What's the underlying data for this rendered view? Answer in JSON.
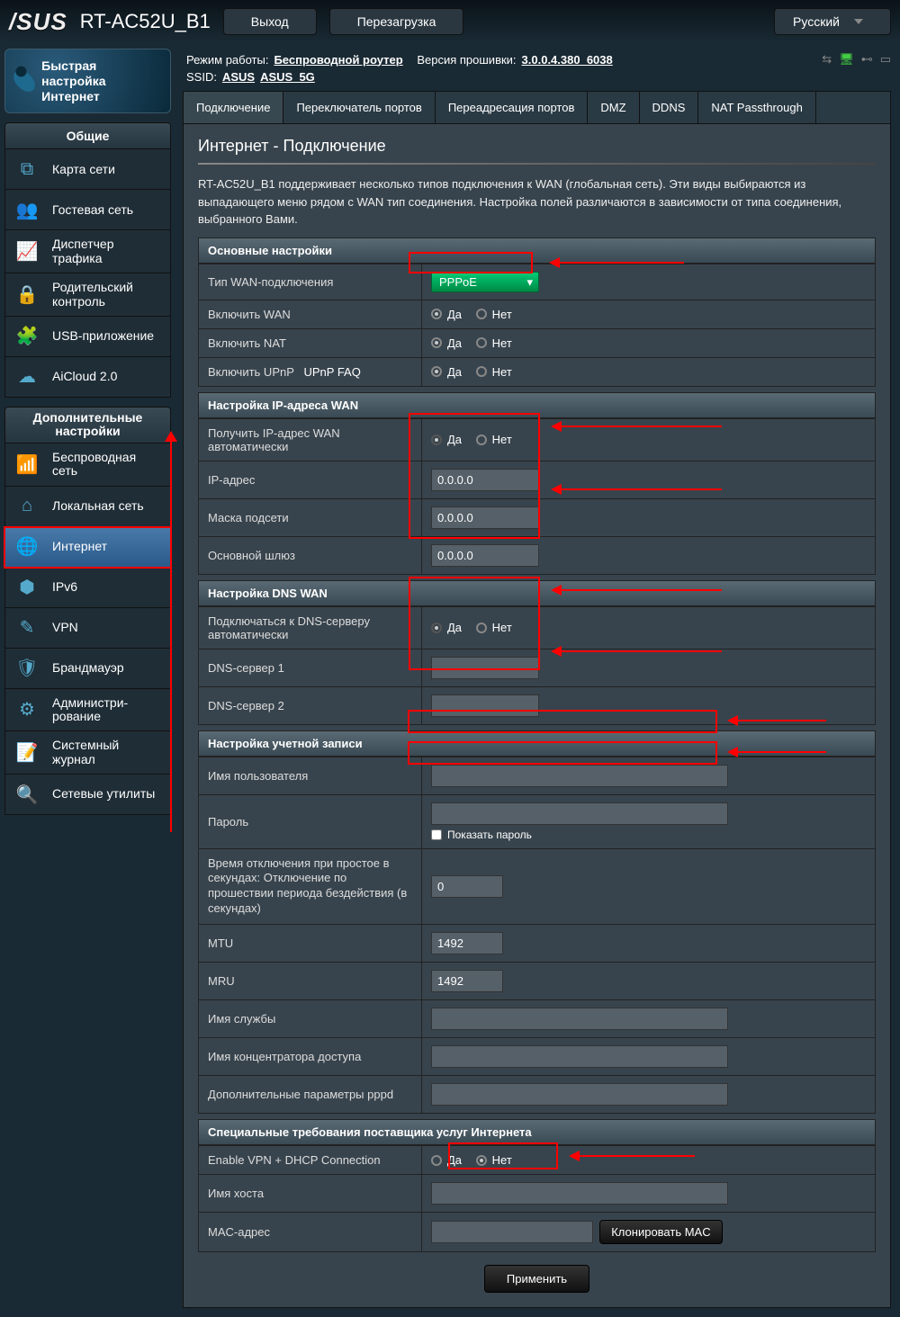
{
  "top": {
    "logo": "/SUS",
    "model": "RT-AC52U_B1",
    "logout": "Выход",
    "reboot": "Перезагрузка",
    "lang": "Русский"
  },
  "status": {
    "mode_label": "Режим работы:",
    "mode_value": "Беспроводной роутер",
    "fw_label": "Версия прошивки:",
    "fw_value": "3.0.0.4.380_6038",
    "ssid_label": "SSID:",
    "ssid1": "ASUS",
    "ssid2": "ASUS_5G"
  },
  "quick": {
    "label": "Быстрая настройка Интернет"
  },
  "menu": {
    "general_title": "Общие",
    "items_general": [
      {
        "label": "Карта сети",
        "icon": "⧉"
      },
      {
        "label": "Гостевая сеть",
        "icon": "👥"
      },
      {
        "label": "Диспетчер трафика",
        "icon": "📈"
      },
      {
        "label": "Родительский контроль",
        "icon": "🔒"
      },
      {
        "label": "USB-приложение",
        "icon": "🧩"
      },
      {
        "label": "AiCloud 2.0",
        "icon": "☁"
      }
    ],
    "advanced_title": "Дополнительные настройки",
    "items_advanced": [
      {
        "label": "Беспроводная сеть",
        "icon": "📶"
      },
      {
        "label": "Локальная сеть",
        "icon": "⌂"
      },
      {
        "label": "Интернет",
        "icon": "🌐",
        "active": true
      },
      {
        "label": "IPv6",
        "icon": "⬢"
      },
      {
        "label": "VPN",
        "icon": "✎"
      },
      {
        "label": "Брандмауэр",
        "icon": "🛡"
      },
      {
        "label": "Администри-рование",
        "icon": "⚙"
      },
      {
        "label": "Системный журнал",
        "icon": "📝"
      },
      {
        "label": "Сетевые утилиты",
        "icon": "🔍"
      }
    ]
  },
  "tabs": [
    "Подключение",
    "Переключатель портов",
    "Переадресация портов",
    "DMZ",
    "DDNS",
    "NAT Passthrough"
  ],
  "page": {
    "title": "Интернет - Подключение",
    "desc": "RT-AC52U_B1 поддерживает несколько типов подключения к WAN (глобальная сеть). Эти виды выбираются из выпадающего меню рядом с WAN тип соединения. Настройка полей различаются в зависимости от типа соединения, выбранного Вами."
  },
  "yes": "Да",
  "no": "Нет",
  "basic": {
    "title": "Основные настройки",
    "wan_type_label": "Тип WAN-подключения",
    "wan_type_value": "PPPoE",
    "enable_wan": "Включить WAN",
    "enable_nat": "Включить NAT",
    "enable_upnp": "Включить UPnP",
    "upnp_faq": "UPnP FAQ"
  },
  "wanip": {
    "title": "Настройка IP-адреса WAN",
    "auto_label": "Получить IP-адрес WAN автоматически",
    "ip_label": "IP-адрес",
    "mask_label": "Маска подсети",
    "gw_label": "Основной шлюз",
    "ip": "0.0.0.0",
    "mask": "0.0.0.0",
    "gw": "0.0.0.0"
  },
  "dns": {
    "title": "Настройка DNS WAN",
    "auto_label": "Подключаться к DNS-серверу автоматически",
    "dns1_label": "DNS-сервер 1",
    "dns2_label": "DNS-сервер 2"
  },
  "acct": {
    "title": "Настройка учетной записи",
    "user_label": "Имя пользователя",
    "pass_label": "Пароль",
    "show_pass": "Показать пароль",
    "idle_label": "Время отключения при простое в секундах: Отключение по прошествии периода бездействия (в секундах)",
    "idle_value": "0",
    "mtu_label": "MTU",
    "mtu": "1492",
    "mru_label": "MRU",
    "mru": "1492",
    "service_label": "Имя службы",
    "concentrator_label": "Имя концентратора доступа",
    "pppd_label": "Дополнительные параметры pppd"
  },
  "isp": {
    "title": "Специальные требования поставщика услуг Интернета",
    "vpn_dhcp_label": "Enable VPN + DHCP Connection",
    "host_label": "Имя хоста",
    "mac_label": "MAC-адрес",
    "clone_mac": "Клонировать MAC"
  },
  "apply": "Применить"
}
